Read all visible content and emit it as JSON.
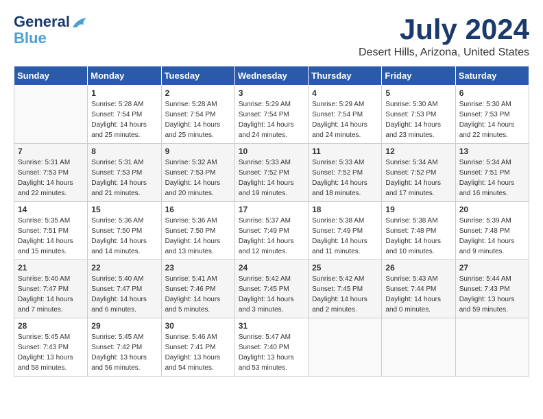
{
  "logo": {
    "line1": "General",
    "line2": "Blue"
  },
  "title": "July 2024",
  "location": "Desert Hills, Arizona, United States",
  "days_of_week": [
    "Sunday",
    "Monday",
    "Tuesday",
    "Wednesday",
    "Thursday",
    "Friday",
    "Saturday"
  ],
  "weeks": [
    [
      {
        "day": "",
        "info": ""
      },
      {
        "day": "1",
        "info": "Sunrise: 5:28 AM\nSunset: 7:54 PM\nDaylight: 14 hours\nand 25 minutes."
      },
      {
        "day": "2",
        "info": "Sunrise: 5:28 AM\nSunset: 7:54 PM\nDaylight: 14 hours\nand 25 minutes."
      },
      {
        "day": "3",
        "info": "Sunrise: 5:29 AM\nSunset: 7:54 PM\nDaylight: 14 hours\nand 24 minutes."
      },
      {
        "day": "4",
        "info": "Sunrise: 5:29 AM\nSunset: 7:54 PM\nDaylight: 14 hours\nand 24 minutes."
      },
      {
        "day": "5",
        "info": "Sunrise: 5:30 AM\nSunset: 7:53 PM\nDaylight: 14 hours\nand 23 minutes."
      },
      {
        "day": "6",
        "info": "Sunrise: 5:30 AM\nSunset: 7:53 PM\nDaylight: 14 hours\nand 22 minutes."
      }
    ],
    [
      {
        "day": "7",
        "info": "Sunrise: 5:31 AM\nSunset: 7:53 PM\nDaylight: 14 hours\nand 22 minutes."
      },
      {
        "day": "8",
        "info": "Sunrise: 5:31 AM\nSunset: 7:53 PM\nDaylight: 14 hours\nand 21 minutes."
      },
      {
        "day": "9",
        "info": "Sunrise: 5:32 AM\nSunset: 7:53 PM\nDaylight: 14 hours\nand 20 minutes."
      },
      {
        "day": "10",
        "info": "Sunrise: 5:33 AM\nSunset: 7:52 PM\nDaylight: 14 hours\nand 19 minutes."
      },
      {
        "day": "11",
        "info": "Sunrise: 5:33 AM\nSunset: 7:52 PM\nDaylight: 14 hours\nand 18 minutes."
      },
      {
        "day": "12",
        "info": "Sunrise: 5:34 AM\nSunset: 7:52 PM\nDaylight: 14 hours\nand 17 minutes."
      },
      {
        "day": "13",
        "info": "Sunrise: 5:34 AM\nSunset: 7:51 PM\nDaylight: 14 hours\nand 16 minutes."
      }
    ],
    [
      {
        "day": "14",
        "info": "Sunrise: 5:35 AM\nSunset: 7:51 PM\nDaylight: 14 hours\nand 15 minutes."
      },
      {
        "day": "15",
        "info": "Sunrise: 5:36 AM\nSunset: 7:50 PM\nDaylight: 14 hours\nand 14 minutes."
      },
      {
        "day": "16",
        "info": "Sunrise: 5:36 AM\nSunset: 7:50 PM\nDaylight: 14 hours\nand 13 minutes."
      },
      {
        "day": "17",
        "info": "Sunrise: 5:37 AM\nSunset: 7:49 PM\nDaylight: 14 hours\nand 12 minutes."
      },
      {
        "day": "18",
        "info": "Sunrise: 5:38 AM\nSunset: 7:49 PM\nDaylight: 14 hours\nand 11 minutes."
      },
      {
        "day": "19",
        "info": "Sunrise: 5:38 AM\nSunset: 7:48 PM\nDaylight: 14 hours\nand 10 minutes."
      },
      {
        "day": "20",
        "info": "Sunrise: 5:39 AM\nSunset: 7:48 PM\nDaylight: 14 hours\nand 9 minutes."
      }
    ],
    [
      {
        "day": "21",
        "info": "Sunrise: 5:40 AM\nSunset: 7:47 PM\nDaylight: 14 hours\nand 7 minutes."
      },
      {
        "day": "22",
        "info": "Sunrise: 5:40 AM\nSunset: 7:47 PM\nDaylight: 14 hours\nand 6 minutes."
      },
      {
        "day": "23",
        "info": "Sunrise: 5:41 AM\nSunset: 7:46 PM\nDaylight: 14 hours\nand 5 minutes."
      },
      {
        "day": "24",
        "info": "Sunrise: 5:42 AM\nSunset: 7:45 PM\nDaylight: 14 hours\nand 3 minutes."
      },
      {
        "day": "25",
        "info": "Sunrise: 5:42 AM\nSunset: 7:45 PM\nDaylight: 14 hours\nand 2 minutes."
      },
      {
        "day": "26",
        "info": "Sunrise: 5:43 AM\nSunset: 7:44 PM\nDaylight: 14 hours\nand 0 minutes."
      },
      {
        "day": "27",
        "info": "Sunrise: 5:44 AM\nSunset: 7:43 PM\nDaylight: 13 hours\nand 59 minutes."
      }
    ],
    [
      {
        "day": "28",
        "info": "Sunrise: 5:45 AM\nSunset: 7:43 PM\nDaylight: 13 hours\nand 58 minutes."
      },
      {
        "day": "29",
        "info": "Sunrise: 5:45 AM\nSunset: 7:42 PM\nDaylight: 13 hours\nand 56 minutes."
      },
      {
        "day": "30",
        "info": "Sunrise: 5:46 AM\nSunset: 7:41 PM\nDaylight: 13 hours\nand 54 minutes."
      },
      {
        "day": "31",
        "info": "Sunrise: 5:47 AM\nSunset: 7:40 PM\nDaylight: 13 hours\nand 53 minutes."
      },
      {
        "day": "",
        "info": ""
      },
      {
        "day": "",
        "info": ""
      },
      {
        "day": "",
        "info": ""
      }
    ]
  ]
}
